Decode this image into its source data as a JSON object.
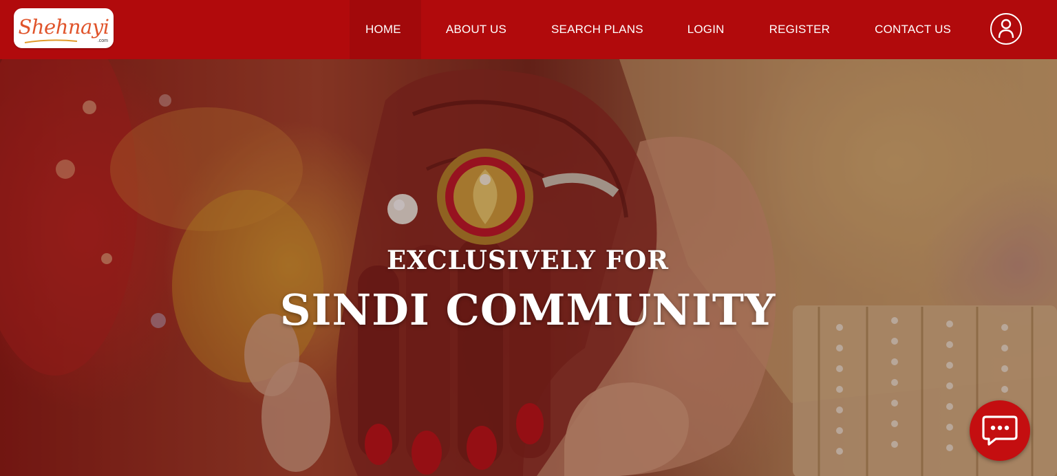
{
  "header": {
    "logo_text": "Shehnayi",
    "logo_suffix": ".com",
    "nav": [
      {
        "label": "HOME",
        "active": true
      },
      {
        "label": "ABOUT US",
        "active": false
      },
      {
        "label": "SEARCH PLANS",
        "active": false
      },
      {
        "label": "LOGIN",
        "active": false
      },
      {
        "label": "REGISTER",
        "active": false
      },
      {
        "label": "CONTACT US",
        "active": false
      }
    ],
    "account_icon": "user-circle-icon"
  },
  "hero": {
    "kicker": "EXCLUSIVELY FOR",
    "headline": "SINDI COMMUNITY"
  },
  "chat": {
    "icon": "chat-bubble-icon"
  },
  "colors": {
    "brand_red": "#b10a0c",
    "active_nav": "#a2090b",
    "chat_red": "#c40e10",
    "logo_orange": "#e0542b",
    "text_white": "#ffffff"
  }
}
